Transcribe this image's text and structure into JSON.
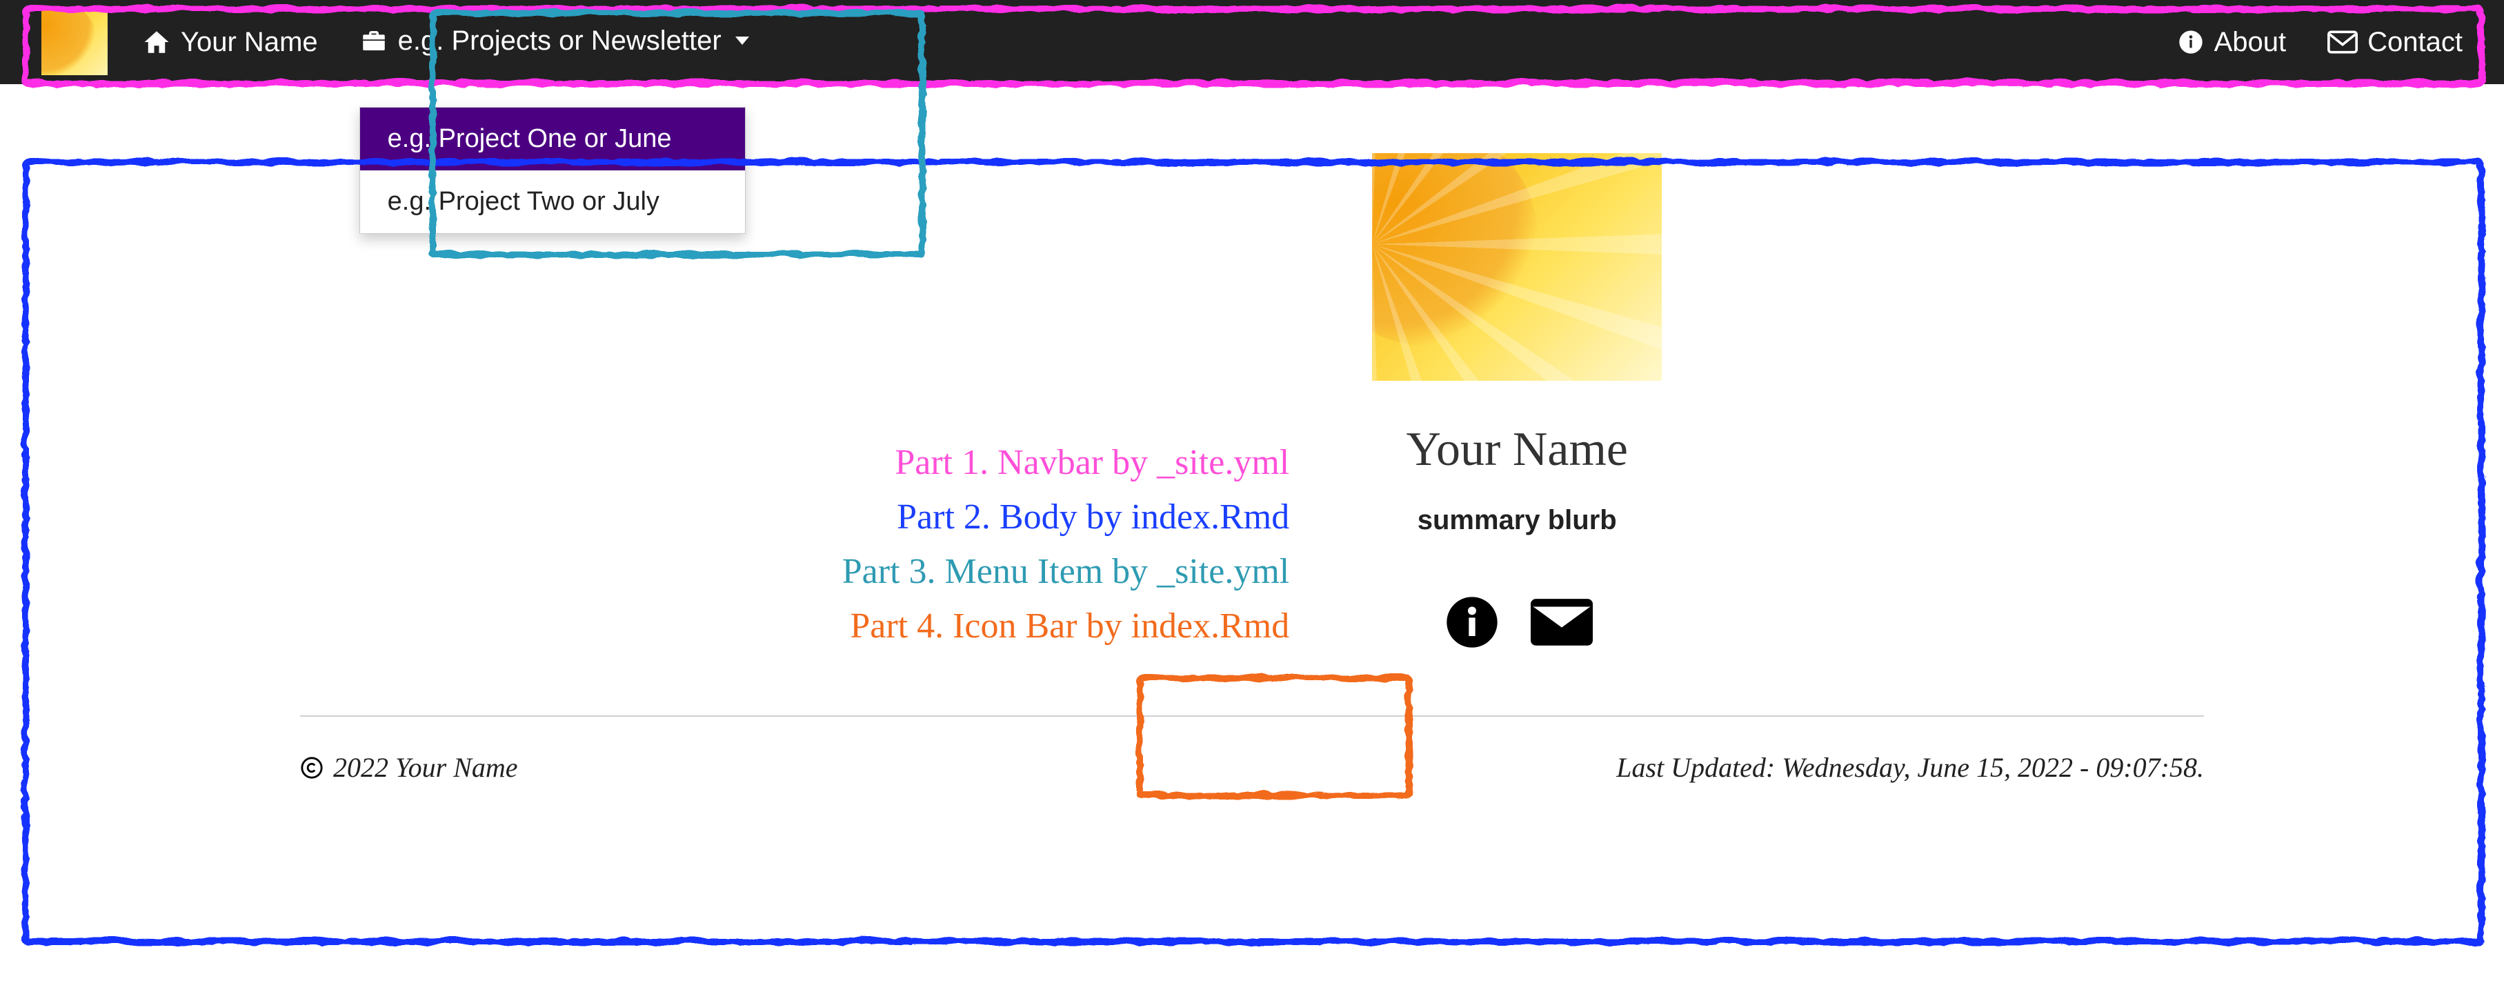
{
  "navbar": {
    "home_label": "Your Name",
    "dropdown_label": "e.g. Projects or Newsletter",
    "dropdown_items": [
      {
        "label": "e.g. Project One or June",
        "active": true
      },
      {
        "label": "e.g. Project Two or July",
        "active": false
      }
    ],
    "about_label": "About",
    "contact_label": "Contact"
  },
  "annotations": {
    "part1": "Part 1. Navbar by _site.yml",
    "part2": "Part 2. Body by index.Rmd",
    "part3": "Part 3. Menu Item by _site.yml",
    "part4": "Part 4. Icon Bar by index.Rmd"
  },
  "profile": {
    "name": "Your Name",
    "summary": "summary blurb"
  },
  "icons": {
    "info": "info-circle-icon",
    "mail": "envelope-icon"
  },
  "footer": {
    "copyright": "2022 Your Name",
    "updated": "Last Updated: Wednesday, June 15, 2022 - 09:07:58."
  },
  "colors": {
    "navbar_bg": "#212121",
    "dropdown_active_bg": "#4b0082",
    "annot_pink": "#ff4fd8",
    "annot_blue": "#1a3fff",
    "annot_teal": "#2e9bb2",
    "annot_orange": "#f26b1d"
  }
}
